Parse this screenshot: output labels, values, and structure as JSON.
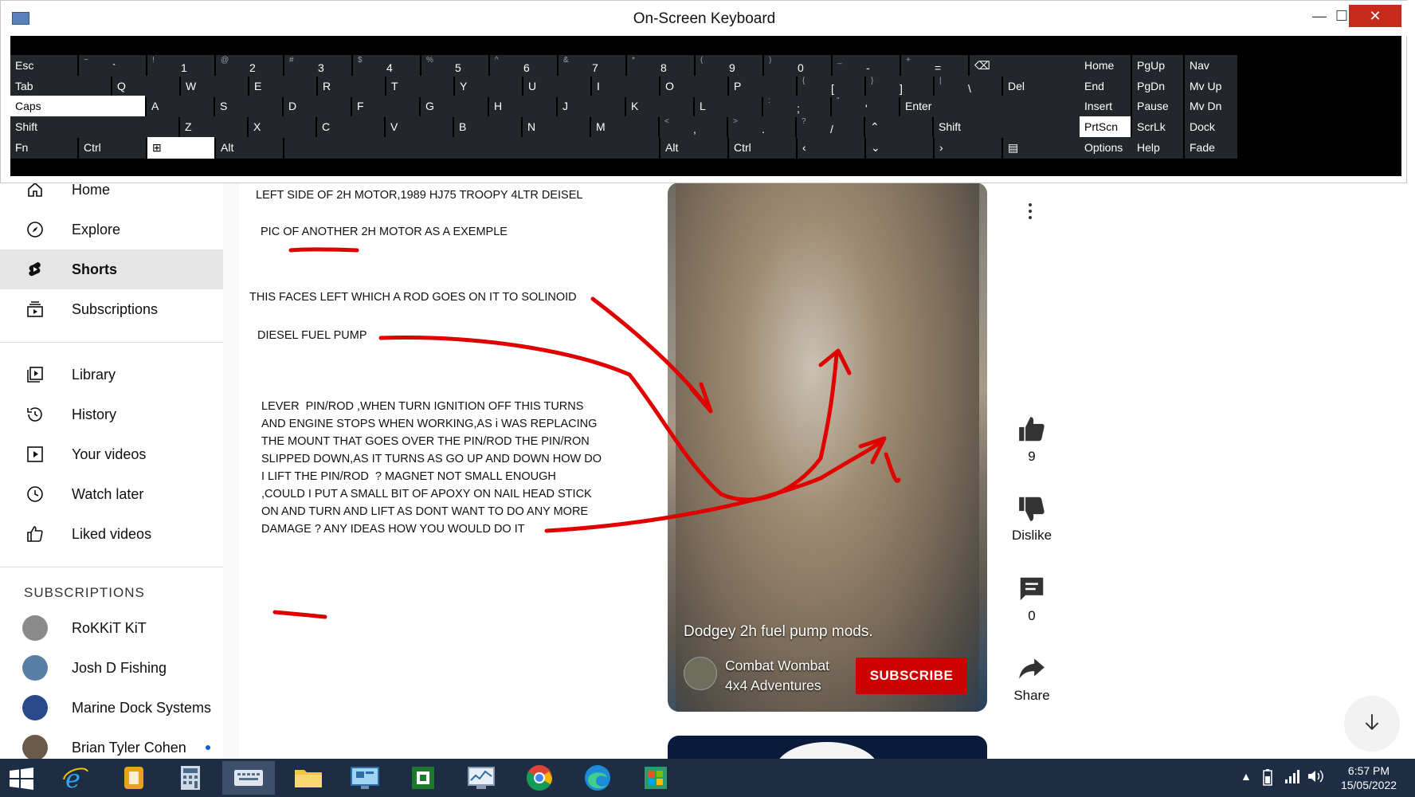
{
  "keyboard": {
    "title": "On-Screen Keyboard",
    "window_controls": {
      "minimize": "—",
      "maximize": "☐",
      "close": "✕"
    },
    "rows": [
      [
        {
          "main": "Esc"
        },
        {
          "shift": "~",
          "main": "`"
        },
        {
          "shift": "!",
          "main": "1"
        },
        {
          "shift": "@",
          "main": "2"
        },
        {
          "shift": "#",
          "main": "3"
        },
        {
          "shift": "$",
          "main": "4"
        },
        {
          "shift": "%",
          "main": "5"
        },
        {
          "shift": "^",
          "main": "6"
        },
        {
          "shift": "&",
          "main": "7"
        },
        {
          "shift": "*",
          "main": "8"
        },
        {
          "shift": "(",
          "main": "9"
        },
        {
          "shift": ")",
          "main": "0"
        },
        {
          "shift": "_",
          "main": "-"
        },
        {
          "shift": "+",
          "main": "="
        },
        {
          "main": "⌫"
        }
      ],
      [
        {
          "main": "Tab"
        },
        {
          "main": "Q"
        },
        {
          "main": "W"
        },
        {
          "main": "E"
        },
        {
          "main": "R"
        },
        {
          "main": "T"
        },
        {
          "main": "Y"
        },
        {
          "main": "U"
        },
        {
          "main": "I"
        },
        {
          "main": "O"
        },
        {
          "main": "P"
        },
        {
          "shift": "{",
          "main": "["
        },
        {
          "shift": "}",
          "main": "]"
        },
        {
          "shift": "|",
          "main": "\\"
        },
        {
          "main": "Del"
        }
      ],
      [
        {
          "main": "Caps"
        },
        {
          "main": "A"
        },
        {
          "main": "S"
        },
        {
          "main": "D"
        },
        {
          "main": "F"
        },
        {
          "main": "G"
        },
        {
          "main": "H"
        },
        {
          "main": "J"
        },
        {
          "main": "K"
        },
        {
          "main": "L"
        },
        {
          "shift": ":",
          "main": ";"
        },
        {
          "shift": "\"",
          "main": "'"
        },
        {
          "main": "Enter"
        }
      ],
      [
        {
          "main": "Shift"
        },
        {
          "main": "Z"
        },
        {
          "main": "X"
        },
        {
          "main": "C"
        },
        {
          "main": "V"
        },
        {
          "main": "B"
        },
        {
          "main": "N"
        },
        {
          "main": "M"
        },
        {
          "shift": "<",
          "main": ","
        },
        {
          "shift": ">",
          "main": "."
        },
        {
          "shift": "?",
          "main": "/"
        },
        {
          "main": "⌃"
        },
        {
          "main": "Shift"
        }
      ],
      [
        {
          "main": "Fn"
        },
        {
          "main": "Ctrl"
        },
        {
          "main": "⊞"
        },
        {
          "main": "Alt"
        },
        {
          "main": ""
        },
        {
          "main": "Alt"
        },
        {
          "main": "Ctrl"
        },
        {
          "main": "‹"
        },
        {
          "main": "⌄"
        },
        {
          "main": "›"
        },
        {
          "main": "▤"
        }
      ]
    ],
    "nav_rows": [
      [
        "Home",
        "PgUp",
        "Nav"
      ],
      [
        "End",
        "PgDn",
        "Mv Up"
      ],
      [
        "Insert",
        "Pause",
        "Mv Dn"
      ],
      [
        "PrtScn",
        "ScrLk",
        "Dock"
      ],
      [
        "Options",
        "Help",
        "Fade"
      ]
    ]
  },
  "sidebar": {
    "items": [
      {
        "label": "Home",
        "icon": "home-icon"
      },
      {
        "label": "Explore",
        "icon": "compass-icon"
      },
      {
        "label": "Shorts",
        "icon": "shorts-icon",
        "active": true
      },
      {
        "label": "Subscriptions",
        "icon": "subscriptions-icon"
      },
      {
        "label": "Library",
        "icon": "library-icon"
      },
      {
        "label": "History",
        "icon": "history-icon"
      },
      {
        "label": "Your videos",
        "icon": "your-videos-icon"
      },
      {
        "label": "Watch later",
        "icon": "watch-later-icon"
      },
      {
        "label": "Liked videos",
        "icon": "thumbs-up-icon"
      }
    ],
    "subscriptions_heading": "SUBSCRIPTIONS",
    "subscriptions": [
      {
        "name": "RoKKiT KiT",
        "color": "#8a8a8a"
      },
      {
        "name": "Josh D Fishing",
        "color": "#5a7fa6"
      },
      {
        "name": "Marine Dock Systems",
        "color": "#2b4a8a"
      },
      {
        "name": "Brian Tyler Cohen",
        "color": "#6b5a4a"
      }
    ]
  },
  "annotations": {
    "line1": "LEFT SIDE OF 2H MOTOR,1989 HJ75 TROOPY 4LTR DEISEL",
    "line2": "PIC OF ANOTHER 2H MOTOR AS A EXEMPLE",
    "line3": "THIS FACES LEFT WHICH A ROD GOES ON IT TO SOLINOID",
    "line4": "DIESEL FUEL PUMP",
    "paragraph": "LEVER  PIN/ROD ,WHEN TURN IGNITION OFF THIS TURNS\nAND ENGINE STOPS WHEN WORKING,AS i WAS REPLACING\nTHE MOUNT THAT GOES OVER THE PIN/ROD THE PIN/RON\nSLIPPED DOWN,AS IT TURNS AS GO UP AND DOWN HOW DO\nI LIFT THE PIN/ROD  ? MAGNET NOT SMALL ENOUGH\n,COULD I PUT A SMALL BIT OF APOXY ON NAIL HEAD STICK\nON AND TURN AND LIFT AS DONT WANT TO DO ANY MORE\nDAMAGE ? ANY IDEAS HOW YOU WOULD DO IT"
  },
  "short": {
    "title": "Dodgey 2h fuel pump mods.",
    "channel": "Combat Wombat\n4x4 Adventures",
    "subscribe_label": "SUBSCRIBE",
    "likes": "9",
    "dislike_label": "Dislike",
    "comments": "0",
    "share_label": "Share"
  },
  "taskbar": {
    "time": "6:57 PM",
    "date": "15/05/2022",
    "apps": [
      "internet-explorer-icon",
      "file-manager-icon",
      "calculator-icon",
      "keyboard-icon",
      "folder-icon",
      "remote-desktop-icon",
      "app-green-icon",
      "system-monitor-icon",
      "chrome-icon",
      "edge-icon",
      "store-icon"
    ],
    "active_app": 3
  },
  "colors": {
    "subscribe": "#cc0000",
    "annotation_red": "#e00000",
    "osk_key": "#23262b",
    "taskbar": "#1d2d44"
  }
}
